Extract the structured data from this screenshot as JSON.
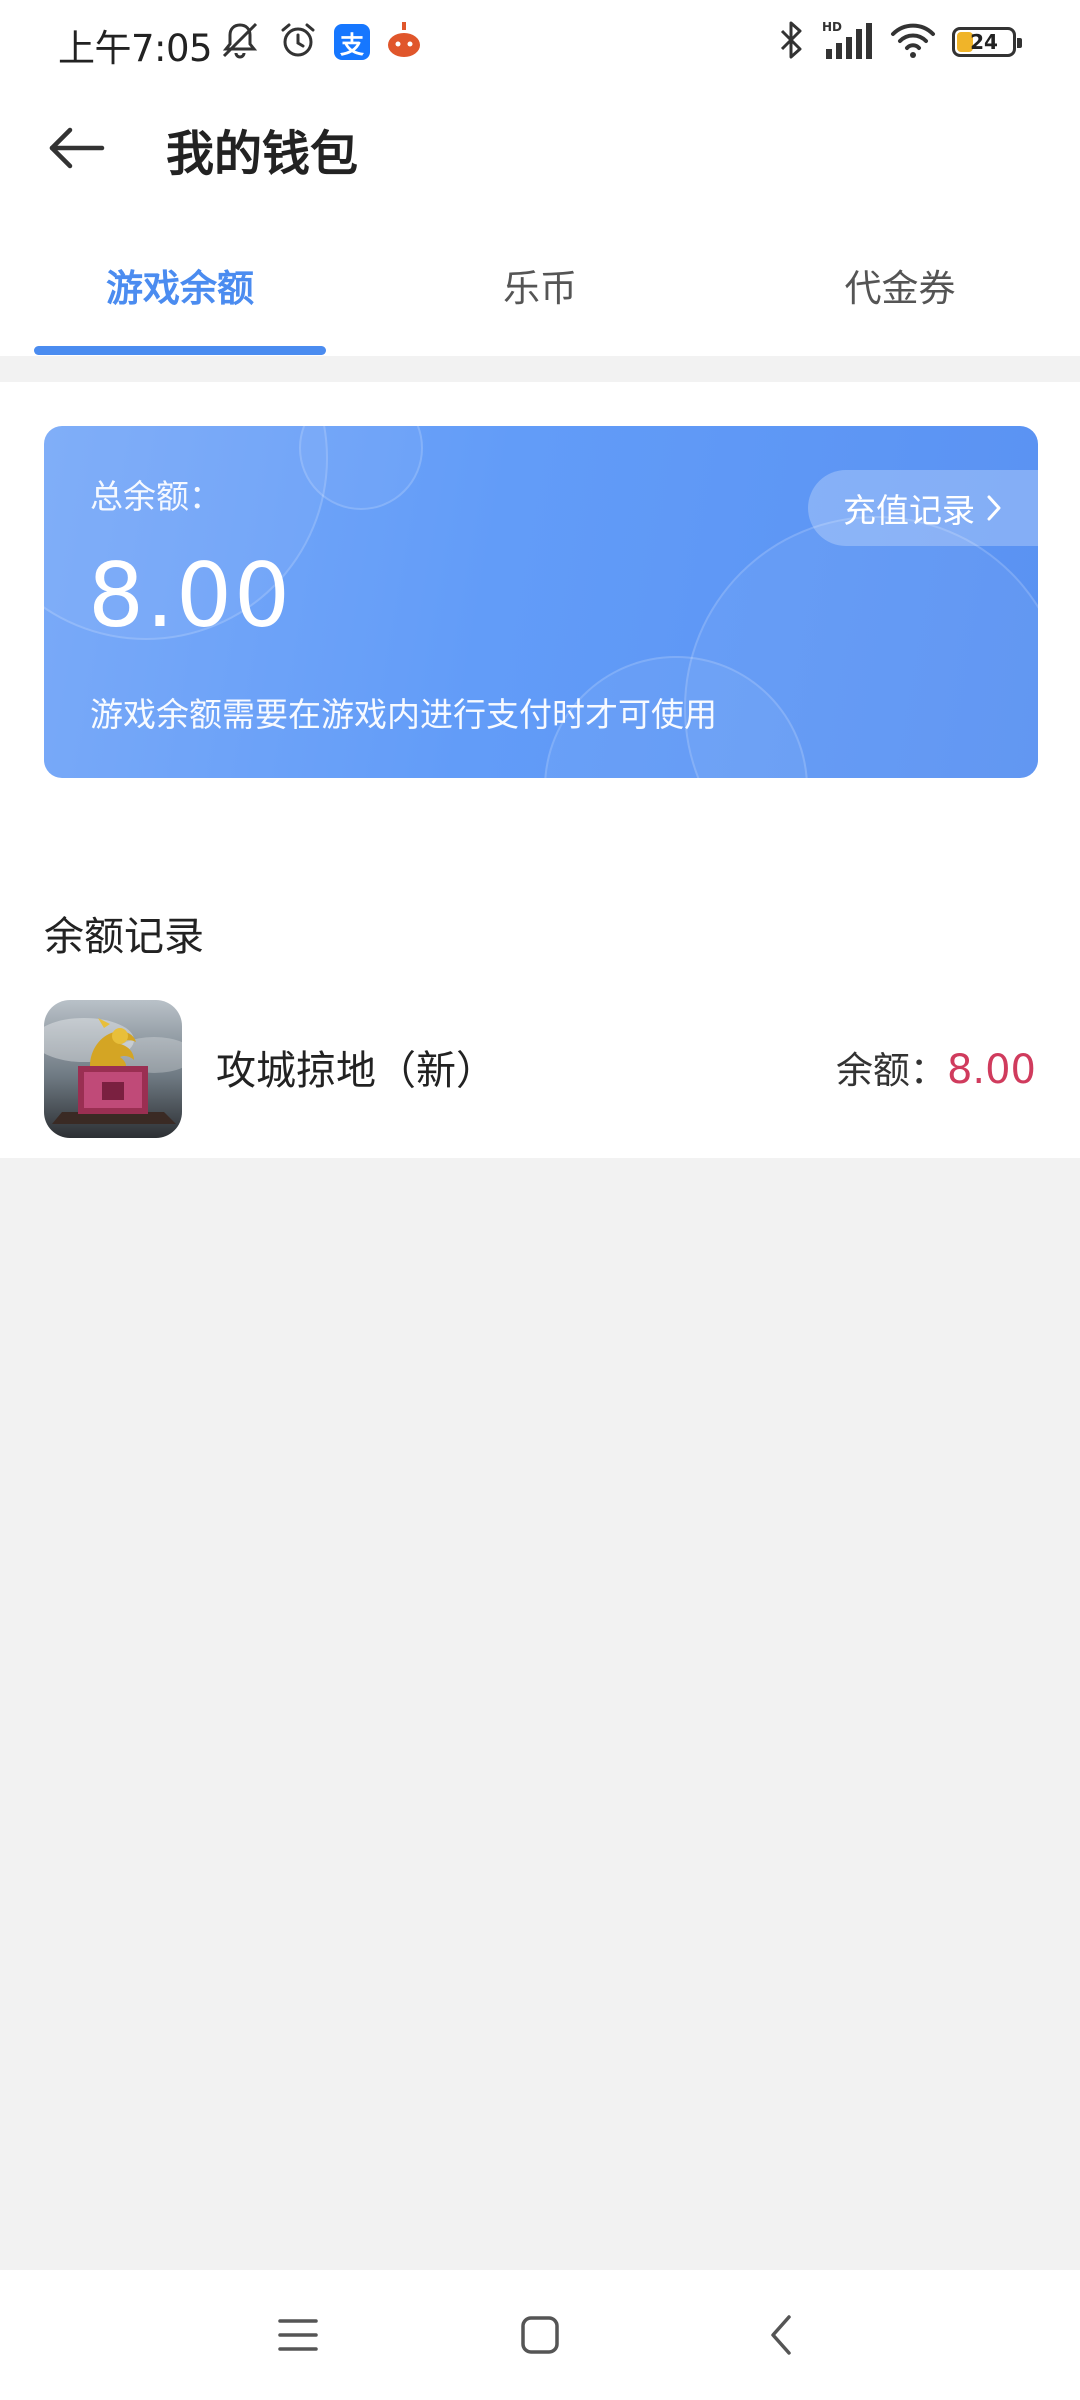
{
  "status_bar": {
    "time": "上午7:05",
    "battery": "24",
    "alipay_glyph": "支",
    "icons": [
      "mute-icon",
      "alarm-icon",
      "alipay-icon",
      "app-notification-icon",
      "bluetooth-icon",
      "hd-signal-icon",
      "wifi-icon",
      "battery-icon"
    ]
  },
  "header": {
    "title": "我的钱包"
  },
  "tabs": [
    {
      "label": "游戏余额",
      "active": true
    },
    {
      "label": "乐币",
      "active": false
    },
    {
      "label": "代金券",
      "active": false
    }
  ],
  "balance_card": {
    "label": "总余额：",
    "amount": "8.00",
    "note": "游戏余额需要在游戏内进行支付时才可使用",
    "recharge_label": "充值记录"
  },
  "records": {
    "title": "余额记录",
    "items": [
      {
        "game": "攻城掠地（新）",
        "balance_label": "余额：",
        "balance_value": "8.00"
      }
    ]
  },
  "colors": {
    "accent": "#4b8cf0",
    "card": "#629cf8",
    "balance_value": "#d03b5d",
    "page_bg": "#f2f2f2"
  }
}
